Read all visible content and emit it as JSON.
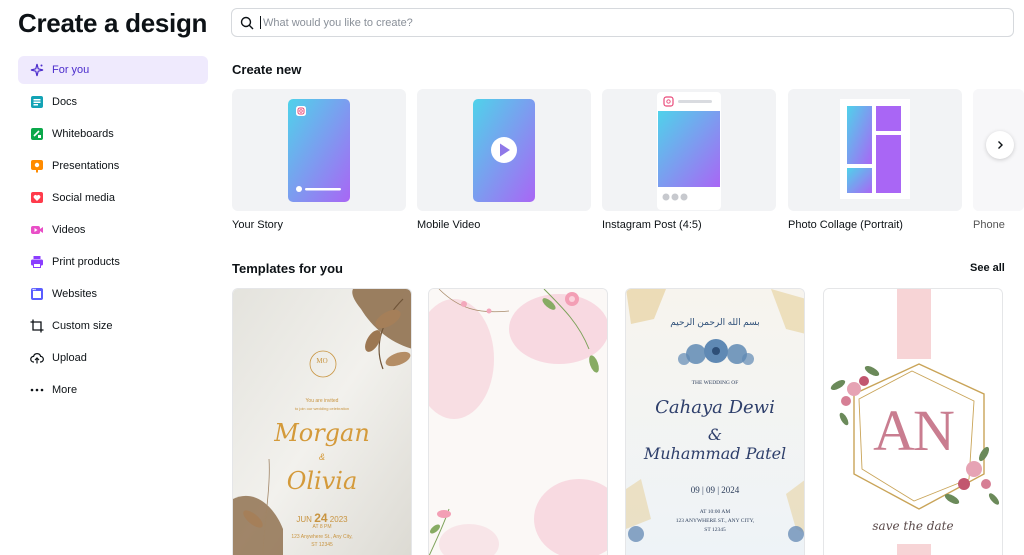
{
  "page": {
    "title": "Create a design"
  },
  "search": {
    "placeholder": "What would you like to create?"
  },
  "sidebar": {
    "items": [
      {
        "label": "For you",
        "icon": "sparkle-icon",
        "active": true
      },
      {
        "label": "Docs",
        "icon": "docs-icon"
      },
      {
        "label": "Whiteboards",
        "icon": "whiteboard-icon"
      },
      {
        "label": "Presentations",
        "icon": "presentation-icon"
      },
      {
        "label": "Social media",
        "icon": "heart-icon"
      },
      {
        "label": "Videos",
        "icon": "video-icon"
      },
      {
        "label": "Print products",
        "icon": "printer-icon"
      },
      {
        "label": "Websites",
        "icon": "website-icon"
      },
      {
        "label": "Custom size",
        "icon": "crop-icon"
      },
      {
        "label": "Upload",
        "icon": "cloud-upload-icon"
      },
      {
        "label": "More",
        "icon": "more-icon"
      }
    ]
  },
  "create_new": {
    "title": "Create new",
    "cards": [
      {
        "label": "Your Story"
      },
      {
        "label": "Mobile Video"
      },
      {
        "label": "Instagram Post (4:5)"
      },
      {
        "label": "Photo Collage (Portrait)"
      },
      {
        "label": "Phone"
      }
    ]
  },
  "templates": {
    "title": "Templates for you",
    "see_all": "See all",
    "t1": {
      "monogram": "MO",
      "invite": "You are invited",
      "invite2": "to join our wedding celebration",
      "name1": "Morgan",
      "amp": "&",
      "name2": "Olivia",
      "month": "JUN",
      "day": "24",
      "year": "2023",
      "time": "AT 8 PM",
      "address": "123 Anywhere St., Any City,",
      "state": "ST 12345"
    },
    "t3": {
      "calligraphy": "بسم الله الرحمن الرحيم",
      "heading": "THE WEDDING OF",
      "name1": "Cahaya Dewi",
      "amp": "&",
      "name2": "Muhammad Patel",
      "date": "09 | 09 | 2024",
      "time": "AT 10:00 AM",
      "address": "123 ANYWHERE ST., ANY CITY,",
      "state": "ST 12345"
    },
    "t4": {
      "initials": "AN",
      "tagline": "save the date"
    }
  },
  "colors": {
    "accent": "#4b2ccc",
    "active_bg": "#efeafd",
    "docs": "#13a3b5",
    "whiteboards": "#0ba84a",
    "presentations": "#ff8b00",
    "social": "#ff3b4b",
    "videos": "#e94fc7",
    "print": "#8b3dff",
    "websites": "#5a5cff"
  }
}
